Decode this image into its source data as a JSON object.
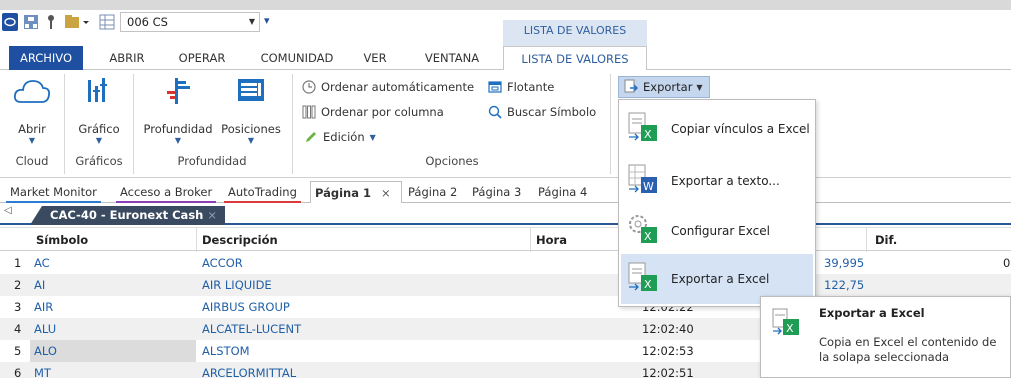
{
  "quick_access": {
    "combo_value": "006 CS",
    "context_header": "LISTA DE VALORES"
  },
  "tabs": [
    {
      "label": "ARCHIVO"
    },
    {
      "label": "ABRIR"
    },
    {
      "label": "OPERAR"
    },
    {
      "label": "COMUNIDAD"
    },
    {
      "label": "VER"
    },
    {
      "label": "VENTANA"
    },
    {
      "label": "LISTA DE VALORES"
    }
  ],
  "ribbon": {
    "abrir_label": "Abrir",
    "grafico_label": "Gráfico",
    "profundidad_label": "Profundidad",
    "posiciones_label": "Posiciones",
    "groups": {
      "cloud": "Cloud",
      "graficos": "Gráficos",
      "profundidad": "Profundidad",
      "opciones": "Opciones"
    },
    "options": {
      "ordenar_auto": "Ordenar automáticamente",
      "flotante": "Flotante",
      "ordenar_columna": "Ordenar por columna",
      "buscar": "Buscar Símbolo",
      "edicion": "Edición"
    },
    "exportar_label": "Exportar"
  },
  "export_menu": {
    "items": [
      {
        "label": "Copiar vínculos a Excel"
      },
      {
        "label": "Exportar a texto..."
      },
      {
        "label": "Configurar Excel"
      },
      {
        "label": "Exportar a Excel"
      }
    ]
  },
  "tooltip": {
    "title": "Exportar a Excel",
    "body": "Copia en Excel el contenido de la solapa seleccionada"
  },
  "page_tabs": [
    {
      "label": "Market Monitor"
    },
    {
      "label": "Acceso a Broker"
    },
    {
      "label": "AutoTrading"
    },
    {
      "label": "Página 1"
    },
    {
      "label": "Página 2"
    },
    {
      "label": "Página 3"
    },
    {
      "label": "Página 4"
    }
  ],
  "sheet_tab": "CAC-40 - Euronext Cash",
  "table": {
    "headers": {
      "simbolo": "Símbolo",
      "descripcion": "Descripción",
      "hora": "Hora",
      "dif": "Dif."
    },
    "rows": [
      {
        "n": "1",
        "simbolo": "AC",
        "descripcion": "ACCOR",
        "hora": "",
        "last": "39,995",
        "dif": "0"
      },
      {
        "n": "2",
        "simbolo": "AI",
        "descripcion": "AIR LIQUIDE",
        "hora": "",
        "last": "122,75",
        "dif": ""
      },
      {
        "n": "3",
        "simbolo": "AIR",
        "descripcion": "AIRBUS GROUP",
        "hora": "12:02:22",
        "last": "",
        "dif": ""
      },
      {
        "n": "4",
        "simbolo": "ALU",
        "descripcion": "ALCATEL-LUCENT",
        "hora": "12:02:40",
        "last": "",
        "dif": ""
      },
      {
        "n": "5",
        "simbolo": "ALO",
        "descripcion": "ALSTOM",
        "hora": "12:02:53",
        "last": "",
        "dif": ""
      },
      {
        "n": "6",
        "simbolo": "MT",
        "descripcion": "ARCELORMITTAL",
        "hora": "12:02:51",
        "last": "",
        "dif": ""
      }
    ]
  },
  "colors": {
    "accent": "#1e4fa0",
    "link": "#1f5fa8",
    "excel_green": "#1f9d55"
  }
}
